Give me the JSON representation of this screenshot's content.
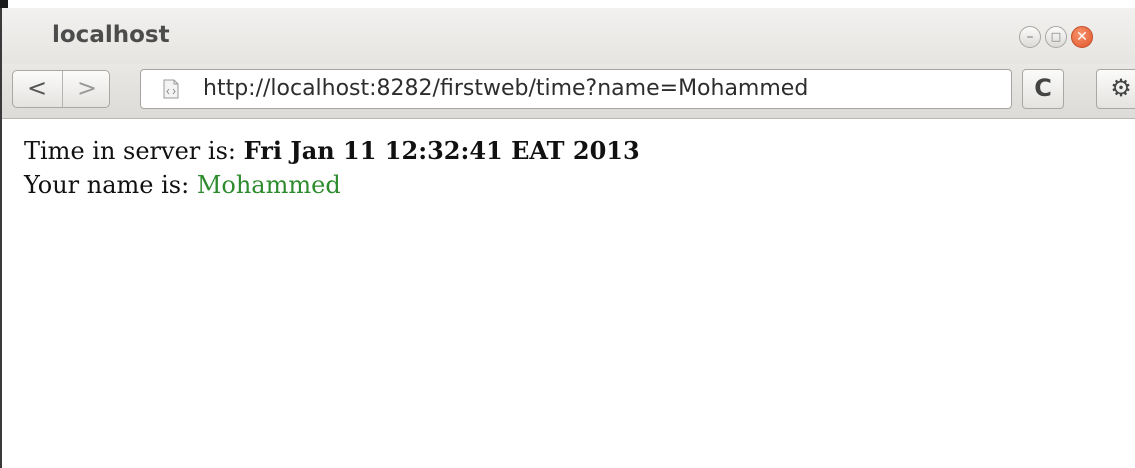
{
  "window": {
    "title": "localhost",
    "minimize_label": "–",
    "maximize_label": "□",
    "close_label": "✕"
  },
  "toolbar": {
    "back_label": "<",
    "forward_label": ">",
    "url": "http://localhost:8282/firstweb/time?name=Mohammed",
    "reload_label": "C",
    "settings_label": "⚙"
  },
  "page": {
    "time_prefix": "Time in server is: ",
    "time_value": "Fri Jan 11 12:32:41 EAT 2013",
    "name_prefix": "Your name is: ",
    "name_value": "Mohammed"
  },
  "colors": {
    "name_value": "#2e8b2e",
    "close_button": "#e0562b"
  },
  "icons": [
    "page-icon",
    "back-icon",
    "forward-icon",
    "reload-icon",
    "settings-icon"
  ]
}
